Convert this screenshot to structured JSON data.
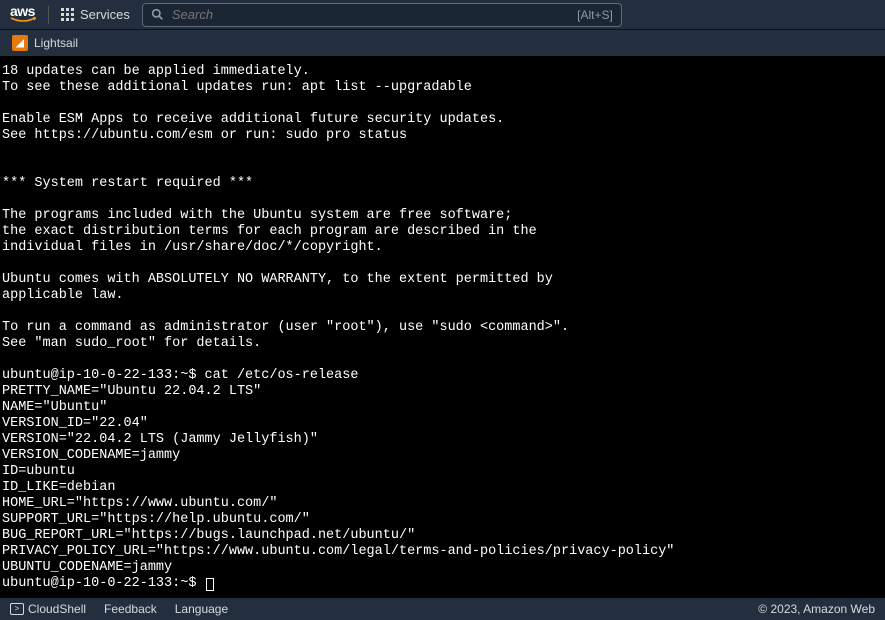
{
  "header": {
    "logo_text": "aws",
    "services_label": "Services",
    "search_placeholder": "Search",
    "search_hint": "[Alt+S]"
  },
  "servicebar": {
    "lightsail_label": "Lightsail"
  },
  "terminal": {
    "lines": [
      "18 updates can be applied immediately.",
      "To see these additional updates run: apt list --upgradable",
      "",
      "Enable ESM Apps to receive additional future security updates.",
      "See https://ubuntu.com/esm or run: sudo pro status",
      "",
      "",
      "*** System restart required ***",
      "",
      "The programs included with the Ubuntu system are free software;",
      "the exact distribution terms for each program are described in the",
      "individual files in /usr/share/doc/*/copyright.",
      "",
      "Ubuntu comes with ABSOLUTELY NO WARRANTY, to the extent permitted by",
      "applicable law.",
      "",
      "To run a command as administrator (user \"root\"), use \"sudo <command>\".",
      "See \"man sudo_root\" for details.",
      "",
      "ubuntu@ip-10-0-22-133:~$ cat /etc/os-release",
      "PRETTY_NAME=\"Ubuntu 22.04.2 LTS\"",
      "NAME=\"Ubuntu\"",
      "VERSION_ID=\"22.04\"",
      "VERSION=\"22.04.2 LTS (Jammy Jellyfish)\"",
      "VERSION_CODENAME=jammy",
      "ID=ubuntu",
      "ID_LIKE=debian",
      "HOME_URL=\"https://www.ubuntu.com/\"",
      "SUPPORT_URL=\"https://help.ubuntu.com/\"",
      "BUG_REPORT_URL=\"https://bugs.launchpad.net/ubuntu/\"",
      "PRIVACY_POLICY_URL=\"https://www.ubuntu.com/legal/terms-and-policies/privacy-policy\"",
      "UBUNTU_CODENAME=jammy"
    ],
    "prompt_final": "ubuntu@ip-10-0-22-133:~$ "
  },
  "footer": {
    "cloudshell": "CloudShell",
    "feedback": "Feedback",
    "language": "Language",
    "copyright": "© 2023, Amazon Web"
  }
}
